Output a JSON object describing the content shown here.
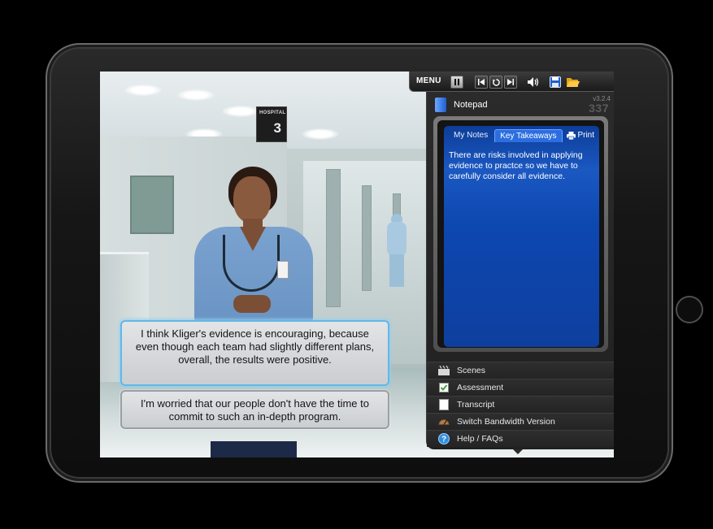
{
  "toolbar": {
    "menu_label": "MENU",
    "pause_icon": "pause-icon",
    "prev_icon": "skip-back-icon",
    "replay_icon": "replay-icon",
    "next_icon": "skip-forward-icon",
    "volume_icon": "volume-icon",
    "save_icon": "save-icon",
    "folder_icon": "folder-icon"
  },
  "scene": {
    "sign_label": "HOSPITAL",
    "sign_number": "3"
  },
  "dialogue": {
    "choices": [
      "I think Kliger's evidence is encouraging, because even though each team had slightly different plans, overall, the results were positive.",
      "I'm worried that our people don't have the time to commit to such an in-depth program."
    ]
  },
  "panel": {
    "notepad_title": "Notepad",
    "version": "v3.2.4",
    "brand": "337",
    "tabs": [
      "My Notes",
      "Key Takeaways"
    ],
    "active_tab": "Key Takeaways",
    "print_label": "Print",
    "note_text": "There are risks involved in applying evidence to practce so we have to carefully consider all evidence.",
    "menu_items": [
      {
        "label": "Scenes",
        "icon": "clapperboard-icon"
      },
      {
        "label": "Assessment",
        "icon": "checkbox-icon"
      },
      {
        "label": "Transcript",
        "icon": "document-icon"
      },
      {
        "label": "Switch Bandwidth Version",
        "icon": "bandwidth-icon"
      },
      {
        "label": "Help / FAQs",
        "icon": "help-icon"
      }
    ]
  },
  "colors": {
    "selection_glow": "#63b7e6",
    "notepad_blue": "#0d47b0",
    "assessment_check": "#3aa63a"
  }
}
